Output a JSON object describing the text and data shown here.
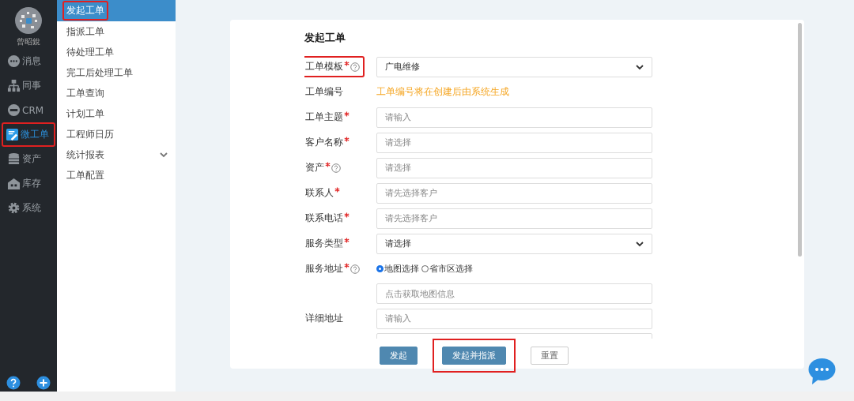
{
  "user": {
    "name": "曾昭銳"
  },
  "main_nav": [
    {
      "label": "消息",
      "selected": false,
      "highlighted": false
    },
    {
      "label": "同事",
      "selected": false,
      "highlighted": false
    },
    {
      "label": "CRM",
      "selected": false,
      "highlighted": false
    },
    {
      "label": "微工单",
      "selected": true,
      "highlighted": true
    },
    {
      "label": "资产",
      "selected": false,
      "highlighted": false
    },
    {
      "label": "库存",
      "selected": false,
      "highlighted": false
    },
    {
      "label": "系统",
      "selected": false,
      "highlighted": false
    }
  ],
  "sub_nav": [
    {
      "label": "发起工单",
      "selected": true,
      "highlighted": true,
      "expandable": false
    },
    {
      "label": "指派工单",
      "selected": false,
      "highlighted": false,
      "expandable": false
    },
    {
      "label": "待处理工单",
      "selected": false,
      "highlighted": false,
      "expandable": false
    },
    {
      "label": "完工后处理工单",
      "selected": false,
      "highlighted": false,
      "expandable": false
    },
    {
      "label": "工单查询",
      "selected": false,
      "highlighted": false,
      "expandable": false
    },
    {
      "label": "计划工单",
      "selected": false,
      "highlighted": false,
      "expandable": false
    },
    {
      "label": "工程师日历",
      "selected": false,
      "highlighted": false,
      "expandable": false
    },
    {
      "label": "统计报表",
      "selected": false,
      "highlighted": false,
      "expandable": true
    },
    {
      "label": "工单配置",
      "selected": false,
      "highlighted": false,
      "expandable": false
    }
  ],
  "form": {
    "title": "发起工单",
    "fields": [
      {
        "kind": "select",
        "label": "工单模板",
        "required": true,
        "help": true,
        "highlighted": true,
        "value": "广电维修"
      },
      {
        "kind": "note",
        "label": "工单编号",
        "required": false,
        "help": false,
        "highlighted": false,
        "note": "工单编号将在创建后由系统生成"
      },
      {
        "kind": "input",
        "label": "工单主题",
        "required": true,
        "help": false,
        "highlighted": false,
        "placeholder": "请输入"
      },
      {
        "kind": "input",
        "label": "客户名称",
        "required": true,
        "help": false,
        "highlighted": false,
        "placeholder": "请选择"
      },
      {
        "kind": "input",
        "label": "资产",
        "required": true,
        "help": true,
        "highlighted": false,
        "placeholder": "请选择"
      },
      {
        "kind": "input",
        "label": "联系人",
        "required": true,
        "help": false,
        "highlighted": false,
        "placeholder": "请先选择客户"
      },
      {
        "kind": "input",
        "label": "联系电话",
        "required": true,
        "help": false,
        "highlighted": false,
        "placeholder": "请先选择客户"
      },
      {
        "kind": "select",
        "label": "服务类型",
        "required": true,
        "help": false,
        "highlighted": false,
        "value": "请选择"
      },
      {
        "kind": "radio",
        "label": "服务地址",
        "required": true,
        "help": true,
        "highlighted": false,
        "options": [
          {
            "label": "地图选择",
            "selected": true
          },
          {
            "label": "省市区选择",
            "selected": false
          }
        ]
      },
      {
        "kind": "input",
        "placeholder": "点击获取地图信息"
      },
      {
        "kind": "input",
        "label": "详细地址",
        "required": false,
        "help": false,
        "highlighted": false,
        "placeholder": "请输入"
      },
      {
        "kind": "input"
      }
    ],
    "buttons": [
      {
        "kind": "primary",
        "label": "发起",
        "highlighted": false
      },
      {
        "kind": "primary",
        "label": "发起并指派",
        "highlighted": true
      },
      {
        "kind": "default",
        "label": "重置",
        "highlighted": false
      }
    ]
  }
}
